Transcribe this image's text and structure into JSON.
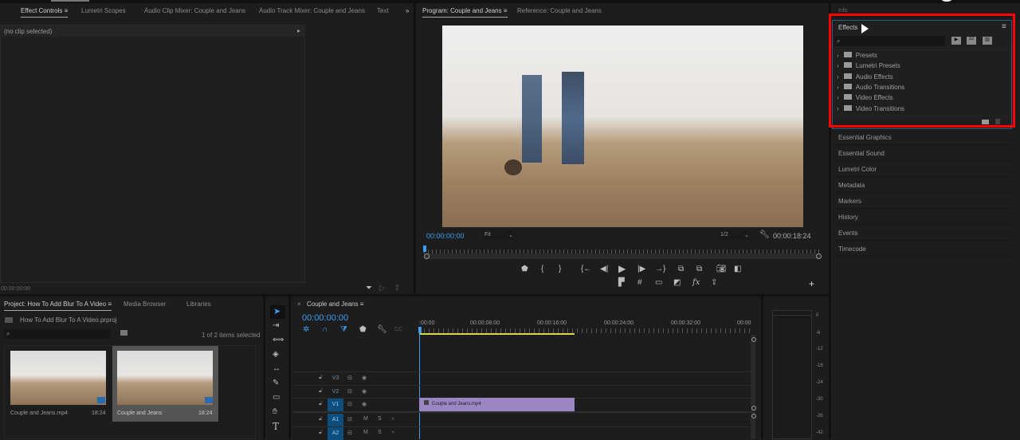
{
  "top_tabs": {
    "left": [
      "Effect Controls",
      "Lumetri Scopes",
      "Audio Clip Mixer: Couple and Jeans",
      "Audio Track Mixer: Couple and Jeans",
      "Text"
    ],
    "overflow": "»",
    "program": "Program: Couple and Jeans",
    "reference": "Reference: Couple and Jeans"
  },
  "effect_controls": {
    "no_clip": "(no clip selected)",
    "timecode": "00:00:00:00"
  },
  "program": {
    "timecode": "00:00:00:00",
    "fit": "Fit",
    "resolution": "1/2",
    "duration": "00:00:18:24",
    "fx_label": "fx"
  },
  "right_panel": {
    "info": "Info",
    "effects_title": "Effects",
    "effects_items": [
      "Presets",
      "Lumetri Presets",
      "Audio Effects",
      "Audio Transitions",
      "Video Effects",
      "Video Transitions"
    ],
    "filter_icons": [
      "32"
    ],
    "panels": [
      "Essential Graphics",
      "Essential Sound",
      "Lumetri Color",
      "Metadata",
      "Markers",
      "History",
      "Events",
      "Timecode"
    ],
    "highlight_color": "#ff0000"
  },
  "project": {
    "tabs": [
      "Project: How To Add Blur To A Video",
      "Media Browser",
      "Libraries"
    ],
    "file": "How To Add Blur To A Video.prproj",
    "selection": "1 of 2 items selected",
    "items": [
      {
        "name": "Couple and Jeans.mp4",
        "duration": "18:24"
      },
      {
        "name": "Couple and Jeans",
        "duration": "18:24"
      }
    ]
  },
  "timeline": {
    "title": "Couple and Jeans",
    "close": "×",
    "timecode": "00:00:00:00",
    "ruler": [
      ":00:00",
      "00:00:08:00",
      "00:00:16:00",
      "00:00:24:00",
      "00:00:32:00",
      "00:00"
    ],
    "tracks": [
      "V3",
      "V2",
      "V1",
      "A1",
      "A2"
    ],
    "mute": "M",
    "solo": "S",
    "clip": "Couple and Jeans.mp4",
    "clip_color": "#9b86c4"
  },
  "meter": {
    "scale": [
      "0",
      "-6",
      "-12",
      "-18",
      "-24",
      "-30",
      "-36",
      "-42"
    ]
  }
}
